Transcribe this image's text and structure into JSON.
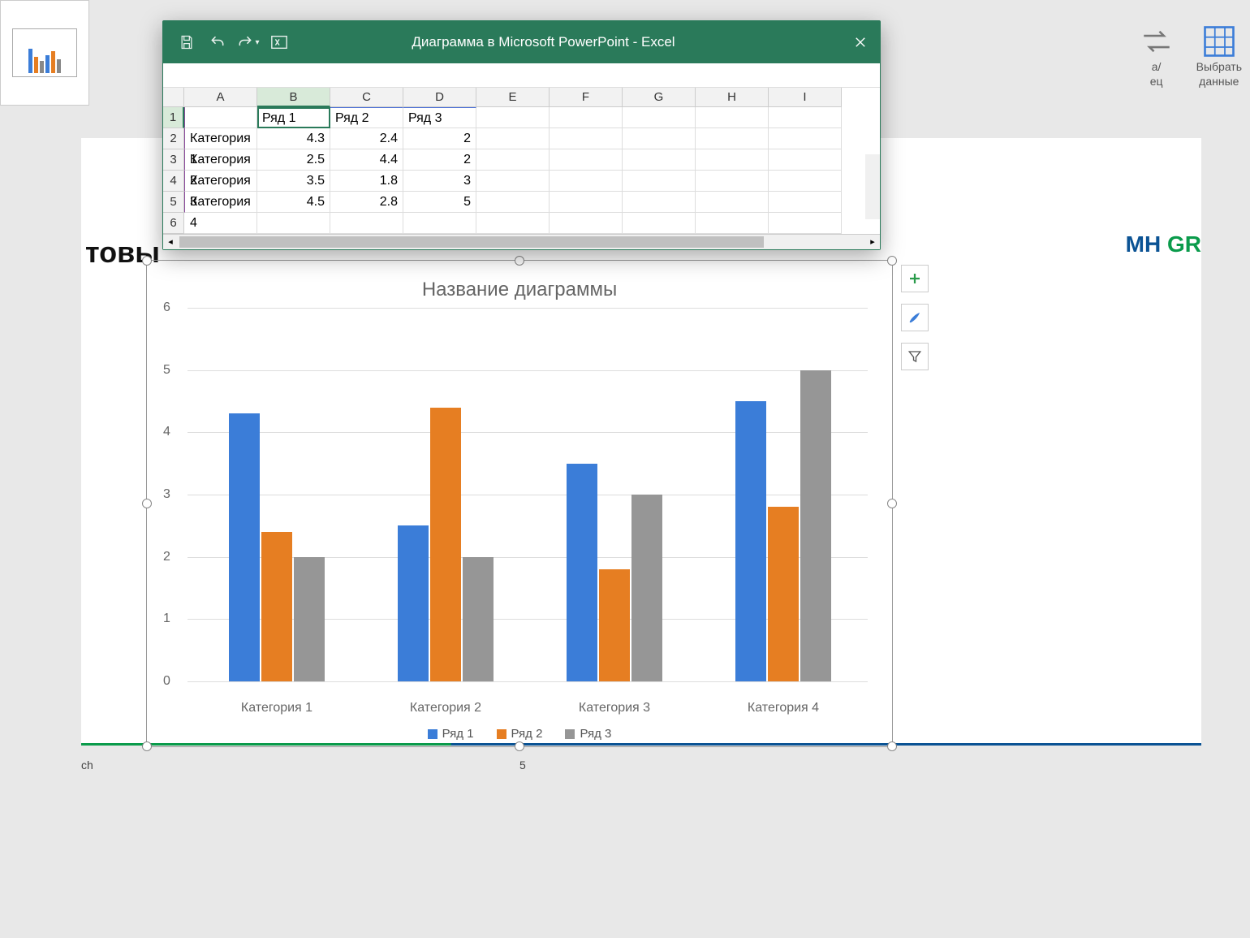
{
  "excel": {
    "title": "Диаграмма в Microsoft PowerPoint  -  Excel",
    "columns": [
      "A",
      "B",
      "C",
      "D",
      "E",
      "F",
      "G",
      "H",
      "I"
    ],
    "active_cell": "B1",
    "headers": [
      "",
      "Ряд 1",
      "Ряд 2",
      "Ряд 3"
    ],
    "rows": [
      {
        "label": "Категория 1",
        "v1": "4.3",
        "v2": "2.4",
        "v3": "2"
      },
      {
        "label": "Категория 2",
        "v1": "2.5",
        "v2": "4.4",
        "v3": "2"
      },
      {
        "label": "Категория 3",
        "v1": "3.5",
        "v2": "1.8",
        "v3": "3"
      },
      {
        "label": "Категория 4",
        "v1": "4.5",
        "v2": "2.8",
        "v3": "5"
      }
    ]
  },
  "ribbon": {
    "switch_label_1": "а/",
    "switch_label_2": "ец",
    "select_data": "Выбрать",
    "select_data_2": "данные"
  },
  "slide": {
    "partial_text": "товы",
    "logo_1": "MH ",
    "logo_2": "GR",
    "status": "ch",
    "slide_no": "5"
  },
  "chart_data": {
    "type": "bar",
    "title": "Название диаграммы",
    "categories": [
      "Категория 1",
      "Категория 2",
      "Категория 3",
      "Категория 4"
    ],
    "series": [
      {
        "name": "Ряд 1",
        "color": "#3b7dd8",
        "values": [
          4.3,
          2.5,
          3.5,
          4.5
        ]
      },
      {
        "name": "Ряд 2",
        "color": "#e67e22",
        "values": [
          2.4,
          4.4,
          1.8,
          2.8
        ]
      },
      {
        "name": "Ряд 3",
        "color": "#969696",
        "values": [
          2,
          2,
          3,
          5
        ]
      }
    ],
    "ylim": [
      0,
      6
    ],
    "yticks": [
      0,
      1,
      2,
      3,
      4,
      5,
      6
    ],
    "xlabel": "",
    "ylabel": ""
  }
}
